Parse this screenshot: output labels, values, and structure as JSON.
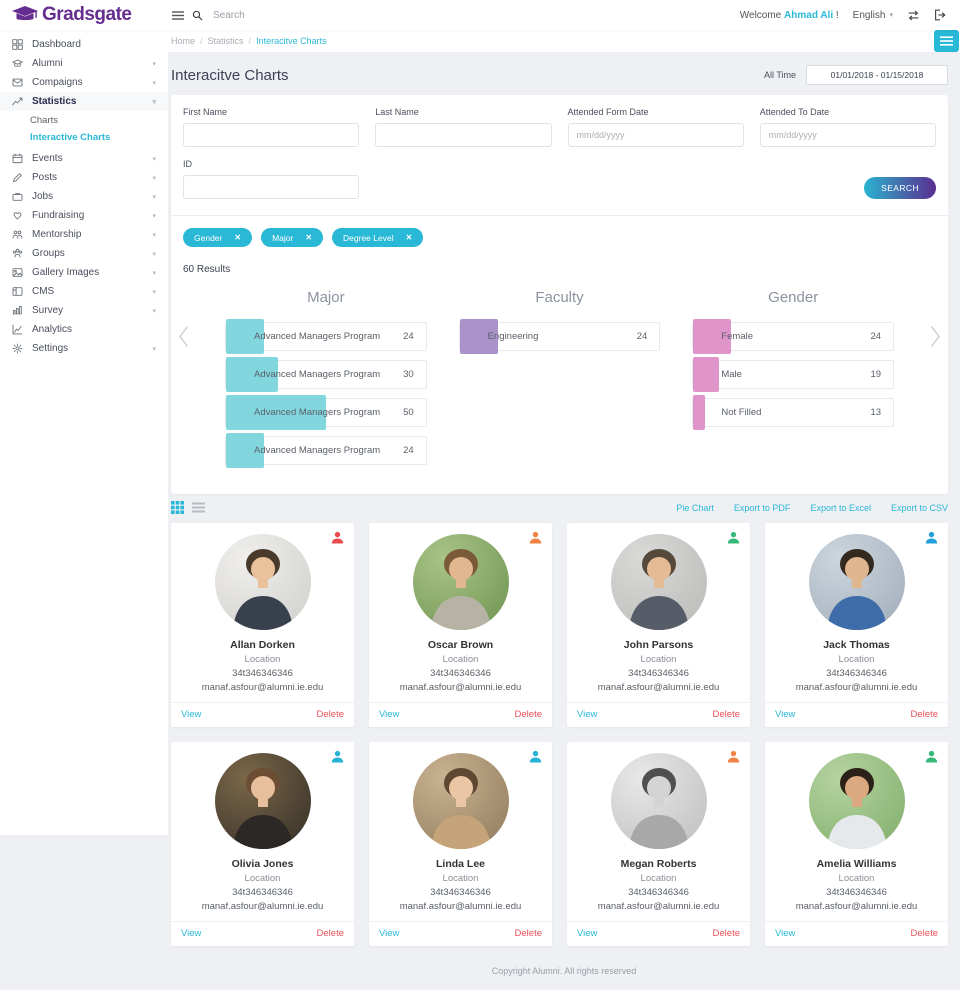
{
  "colors": {
    "accent": "#29b8d6",
    "brand": "#662d91"
  },
  "header": {
    "brand": "Gradsgate",
    "search_placeholder": "Search",
    "welcome_prefix": "Welcome",
    "welcome_name": "Ahmad Ali",
    "welcome_suffix": "!",
    "language": "English"
  },
  "sidebar": {
    "items": [
      {
        "label": "Dashboard",
        "icon": "dashboard-icon",
        "caret": false,
        "active": false
      },
      {
        "label": "Alumni",
        "icon": "alumni-icon",
        "caret": true,
        "active": false
      },
      {
        "label": "Compaigns",
        "icon": "campaigns-icon",
        "caret": true,
        "active": false
      },
      {
        "label": "Statistics",
        "icon": "statistics-icon",
        "caret": true,
        "active": true
      },
      {
        "label": "Events",
        "icon": "events-icon",
        "caret": true,
        "active": false
      },
      {
        "label": "Posts",
        "icon": "posts-icon",
        "caret": true,
        "active": false
      },
      {
        "label": "Jobs",
        "icon": "jobs-icon",
        "caret": true,
        "active": false
      },
      {
        "label": "Fundraising",
        "icon": "fundraising-icon",
        "caret": true,
        "active": false
      },
      {
        "label": "Mentorship",
        "icon": "mentorship-icon",
        "caret": true,
        "active": false
      },
      {
        "label": "Groups",
        "icon": "groups-icon",
        "caret": true,
        "active": false
      },
      {
        "label": "Gallery Images",
        "icon": "gallery-icon",
        "caret": true,
        "active": false
      },
      {
        "label": "CMS",
        "icon": "cms-icon",
        "caret": true,
        "active": false
      },
      {
        "label": "Survey",
        "icon": "survey-icon",
        "caret": true,
        "active": false
      },
      {
        "label": "Analytics",
        "icon": "analytics-icon",
        "caret": false,
        "active": false
      },
      {
        "label": "Settings",
        "icon": "settings-icon",
        "caret": true,
        "active": false
      }
    ],
    "statistics_submenu": [
      {
        "label": "Charts",
        "active": false
      },
      {
        "label": "Interactive Charts",
        "active": true
      }
    ]
  },
  "breadcrumb": [
    "Home",
    "Statistics",
    "Interacitve Charts"
  ],
  "page": {
    "title": "Interacitve Charts",
    "time_filter_label": "All Time",
    "date_range": "01/01/2018 - 01/15/2018"
  },
  "filters": {
    "first_name_label": "First Name",
    "last_name_label": "Last Name",
    "from_date_label": "Attended Form Date",
    "to_date_label": "Attended To Date",
    "id_label": "ID",
    "date_placeholder": "mm/dd/yyyy",
    "search_label": "SEARCH",
    "chips": [
      "Gender",
      "Major",
      "Degree Level"
    ]
  },
  "results_count": "60 Results",
  "chart_data": [
    {
      "type": "bar",
      "orientation": "horizontal",
      "title": "Major",
      "color": "#7bd5dd",
      "xlim": [
        0,
        50
      ],
      "value_labels": true,
      "categories": [
        "Advanced Managers Program",
        "Advanced Managers Program",
        "Advanced Managers Program",
        "Advanced Managers Program"
      ],
      "values": [
        24,
        30,
        50,
        24
      ]
    },
    {
      "type": "bar",
      "orientation": "horizontal",
      "title": "Faculty",
      "color": "#a58cc8",
      "xlim": [
        0,
        50
      ],
      "value_labels": true,
      "categories": [
        "Engineering"
      ],
      "values": [
        24
      ]
    },
    {
      "type": "bar",
      "orientation": "horizontal",
      "title": "Gender",
      "color": "#dd8fc7",
      "xlim": [
        0,
        50
      ],
      "value_labels": true,
      "categories": [
        "Female",
        "Male",
        "Not Filled"
      ],
      "values": [
        24,
        19,
        13
      ]
    }
  ],
  "toolbar_links": [
    "Pie Chart",
    "Export to PDF",
    "Export to Excel",
    "Export to CSV"
  ],
  "card_actions": {
    "view": "View",
    "delete": "Delete"
  },
  "cards": [
    {
      "name": "Allan Dorken",
      "location": "Location",
      "phone": "34t346346346",
      "email": "manaf.asfour@alumni.ie.edu",
      "status_color": "#e84b4b",
      "avatar": {
        "bg1": "#f0efed",
        "bg2": "#cfcecb",
        "hair": "#4a3a2c",
        "skin": "#e9c29c",
        "body": "#39404e"
      }
    },
    {
      "name": "Oscar Brown",
      "location": "Location",
      "phone": "34t346346346",
      "email": "manaf.asfour@alumni.ie.edu",
      "status_color": "#f08143",
      "avatar": {
        "bg1": "#a8c487",
        "bg2": "#6e9350",
        "hair": "#7a5a38",
        "skin": "#e2b68e",
        "body": "#b6b2a4"
      }
    },
    {
      "name": "John Parsons",
      "location": "Location",
      "phone": "34t346346346",
      "email": "manaf.asfour@alumni.ie.edu",
      "status_color": "#35b879",
      "avatar": {
        "bg1": "#d9dad8",
        "bg2": "#b9bab8",
        "hair": "#55493a",
        "skin": "#e4bb95",
        "body": "#565c68"
      }
    },
    {
      "name": "Jack Thomas",
      "location": "Location",
      "phone": "34t346346346",
      "email": "manaf.asfour@alumni.ie.edu",
      "status_color": "#239fd8",
      "avatar": {
        "bg1": "#cdd6de",
        "bg2": "#9fabb8",
        "hair": "#342a20",
        "skin": "#e0b68f",
        "body": "#3e6ca8"
      }
    },
    {
      "name": "Olivia Jones",
      "location": "Location",
      "phone": "34t346346346",
      "email": "manaf.asfour@alumni.ie.edu",
      "status_color": "#25b2d5",
      "avatar": {
        "bg1": "#7a6749",
        "bg2": "#332d26",
        "hair": "#6d4c34",
        "skin": "#e7bf9d",
        "body": "#2b2826"
      }
    },
    {
      "name": "Linda Lee",
      "location": "Location",
      "phone": "34t346346346",
      "email": "manaf.asfour@alumni.ie.edu",
      "status_color": "#25b2d5",
      "avatar": {
        "bg1": "#c9b291",
        "bg2": "#8f7a5c",
        "hair": "#5f4733",
        "skin": "#eac6a4",
        "body": "#c4a478"
      }
    },
    {
      "name": "Megan Roberts",
      "location": "Location",
      "phone": "34t346346346",
      "email": "manaf.asfour@alumni.ie.edu",
      "status_color": "#f08143",
      "avatar": {
        "bg1": "#e8e8e8",
        "bg2": "#bdbdbd",
        "hair": "#4f4f4f",
        "skin": "#d4d4d4",
        "body": "#a8a8a8"
      }
    },
    {
      "name": "Amelia Williams",
      "location": "Location",
      "phone": "34t346346346",
      "email": "manaf.asfour@alumni.ie.edu",
      "status_color": "#35b879",
      "avatar": {
        "bg1": "#b5d3a0",
        "bg2": "#7fae6a",
        "hair": "#2c2118",
        "skin": "#dba87f",
        "body": "#e6e9ec"
      }
    }
  ],
  "footer": "Copyright Alumni. All rights reserved"
}
